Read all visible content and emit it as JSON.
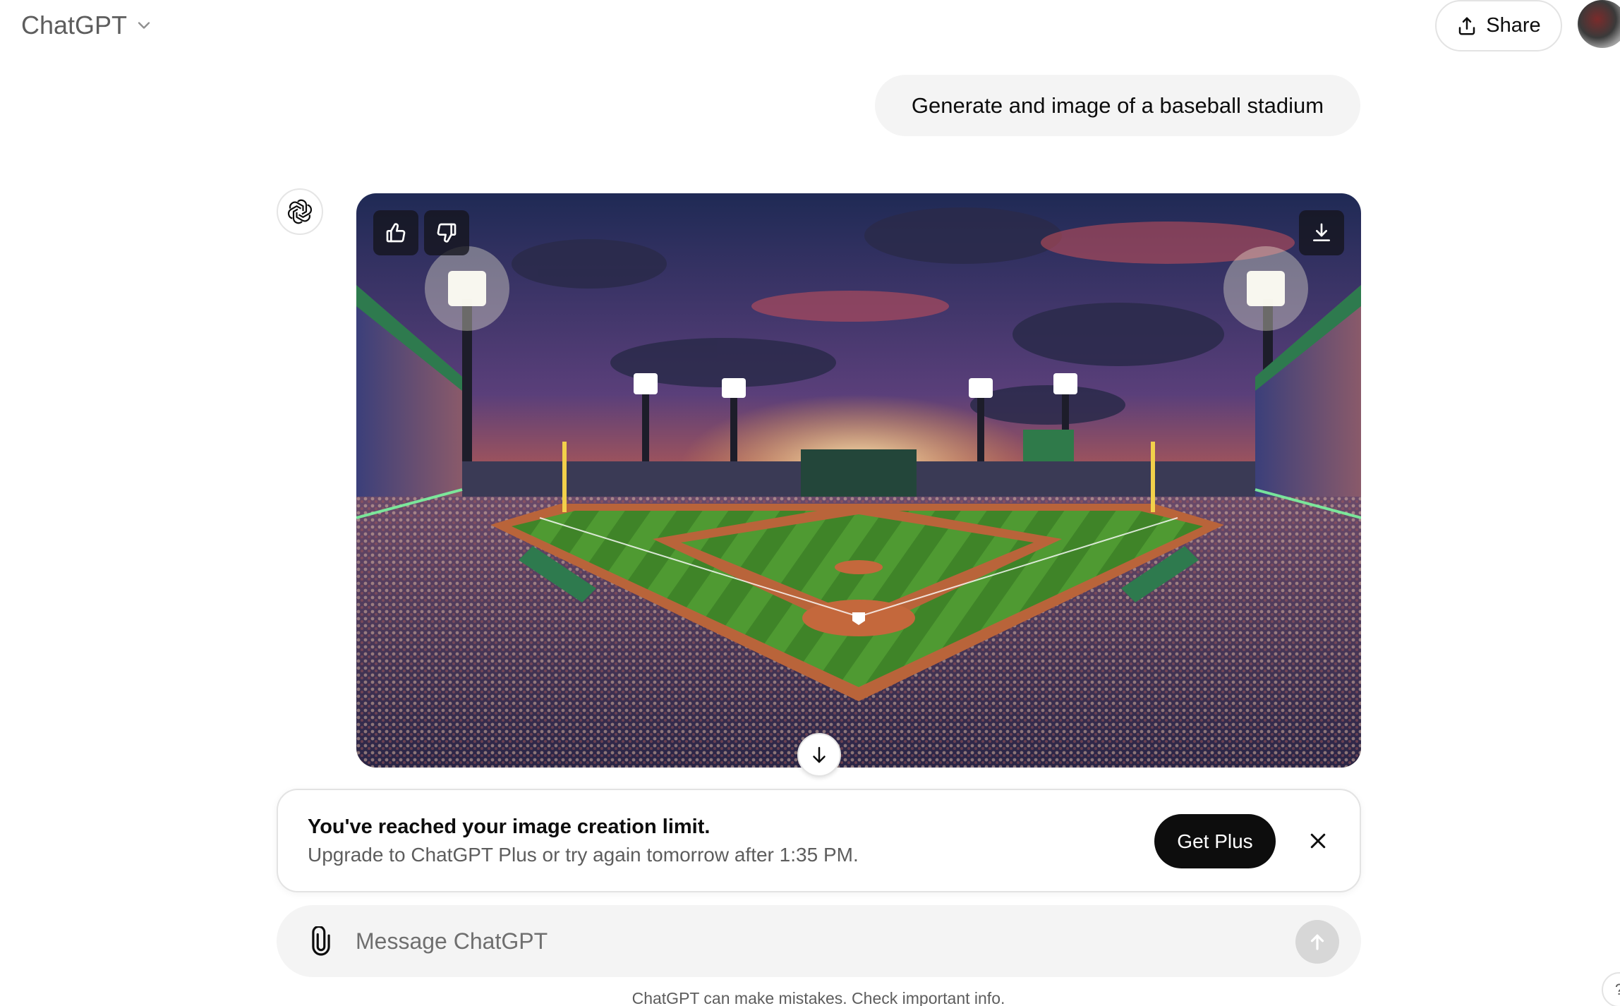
{
  "header": {
    "model_title": "ChatGPT",
    "share_label": "Share"
  },
  "conversation": {
    "user_message": "Generate and image of a baseball stadium",
    "assistant_image_subject": "baseball stadium at sunset"
  },
  "limit_banner": {
    "title": "You've reached your image creation limit.",
    "subtitle": "Upgrade to ChatGPT Plus or try again tomorrow after 1:35 PM.",
    "cta_label": "Get Plus"
  },
  "composer": {
    "placeholder": "Message ChatGPT"
  },
  "footer": {
    "note": "ChatGPT can make mistakes. Check important info.",
    "help_label": "?"
  },
  "icons": {
    "model_dropdown": "chevron-down-icon",
    "share": "share-icon",
    "assistant": "openai-logo-icon",
    "like": "thumbs-up-icon",
    "dislike": "thumbs-down-icon",
    "download": "download-icon",
    "scroll": "arrow-down-icon",
    "close": "close-icon",
    "attach": "paperclip-icon",
    "send": "arrow-up-icon"
  },
  "colors": {
    "accent_dark": "#0d0d0d",
    "bubble_bg": "#f4f4f4",
    "border": "#e3e3e3",
    "muted_text": "#5d5d5d"
  }
}
